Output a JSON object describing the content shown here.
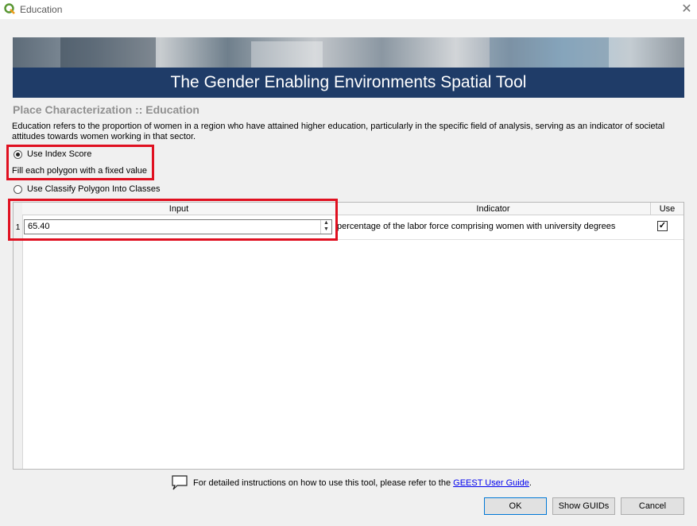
{
  "window": {
    "title": "Education"
  },
  "banner": {
    "title": "The Gender Enabling Environments Spatial Tool"
  },
  "page": {
    "heading": "Place Characterization :: Education",
    "description": "Education refers to the proportion of women in a region who have attained higher education, particularly in the specific field of analysis, serving as an indicator of societal attitudes towards women working in that sector."
  },
  "options": {
    "index_score_label": "Use Index Score",
    "index_score_hint": "Fill each polygon with a fixed value",
    "classify_label": "Use Classify Polygon Into Classes",
    "selected": "index_score"
  },
  "table": {
    "headers": {
      "input": "Input",
      "indicator": "Indicator",
      "use": "Use"
    },
    "rows": [
      {
        "num": "1",
        "input": "65.40",
        "indicator": "percentage of the labor force comprising women with university degrees",
        "use": true
      }
    ]
  },
  "footer": {
    "text": "For detailed instructions on how to use this tool, please refer to the",
    "link": "GEEST User Guide",
    "end": "."
  },
  "buttons": {
    "ok": "OK",
    "show_guids": "Show GUIDs",
    "cancel": "Cancel"
  },
  "colors": {
    "highlight": "#e01020",
    "banner_band": "#1f3c68",
    "link": "#0000ee"
  },
  "icons": {
    "app": "qgis-logo-icon",
    "close": "close-icon",
    "help": "speech-bubble-icon"
  }
}
